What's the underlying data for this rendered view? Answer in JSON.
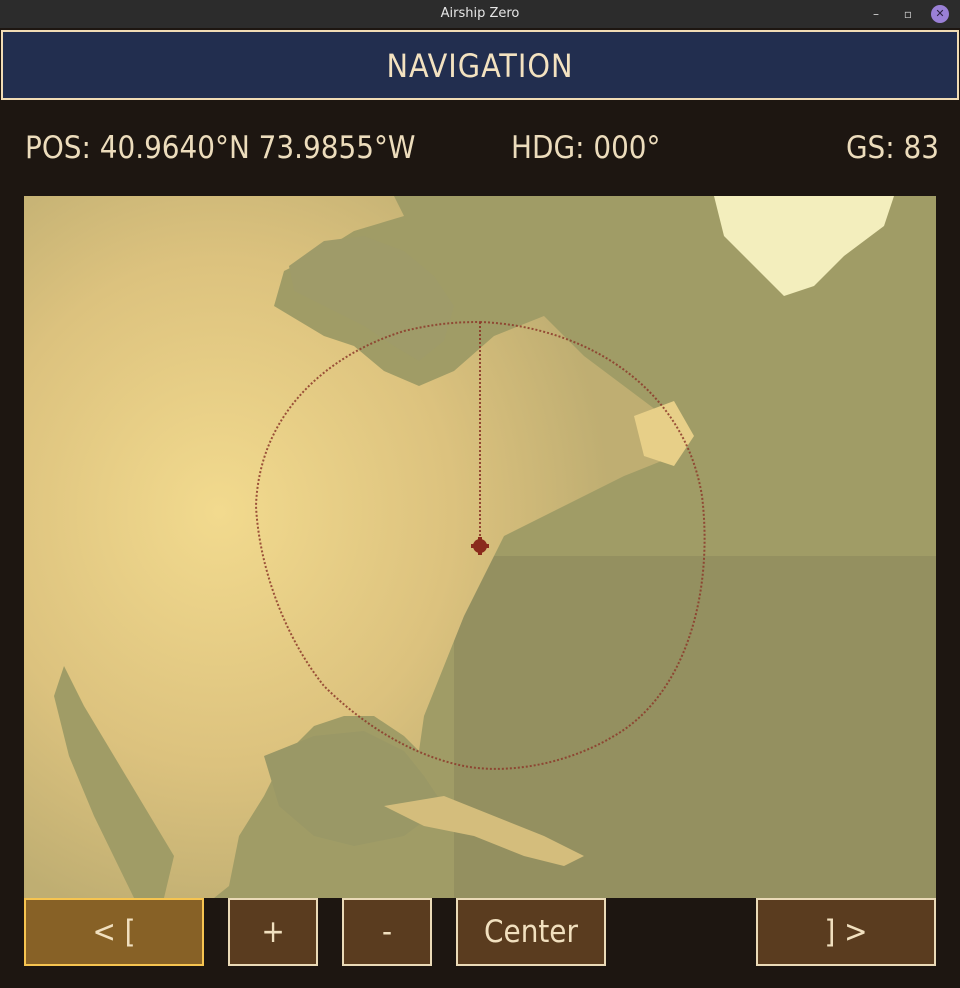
{
  "window": {
    "title": "Airship Zero",
    "minimize_icon": "minimize-icon",
    "restore_icon": "restore-icon",
    "close_icon": "close-icon"
  },
  "header": {
    "title": "NAVIGATION"
  },
  "status": {
    "position": "POS: 40.9640°N 73.9855°W",
    "heading": "HDG: 000°",
    "ground_speed": "GS: 83"
  },
  "map": {
    "range_ring_color": "#8c3a2a",
    "aircraft_marker_color": "#8a2a1c",
    "land_color": "#e7cf88",
    "water_color": "#9b996a",
    "ice_color": "#f3eebd"
  },
  "controls": {
    "prev_label": "< [",
    "zoom_in_label": "+",
    "zoom_out_label": "-",
    "center_label": "Center",
    "next_label": "] >"
  }
}
